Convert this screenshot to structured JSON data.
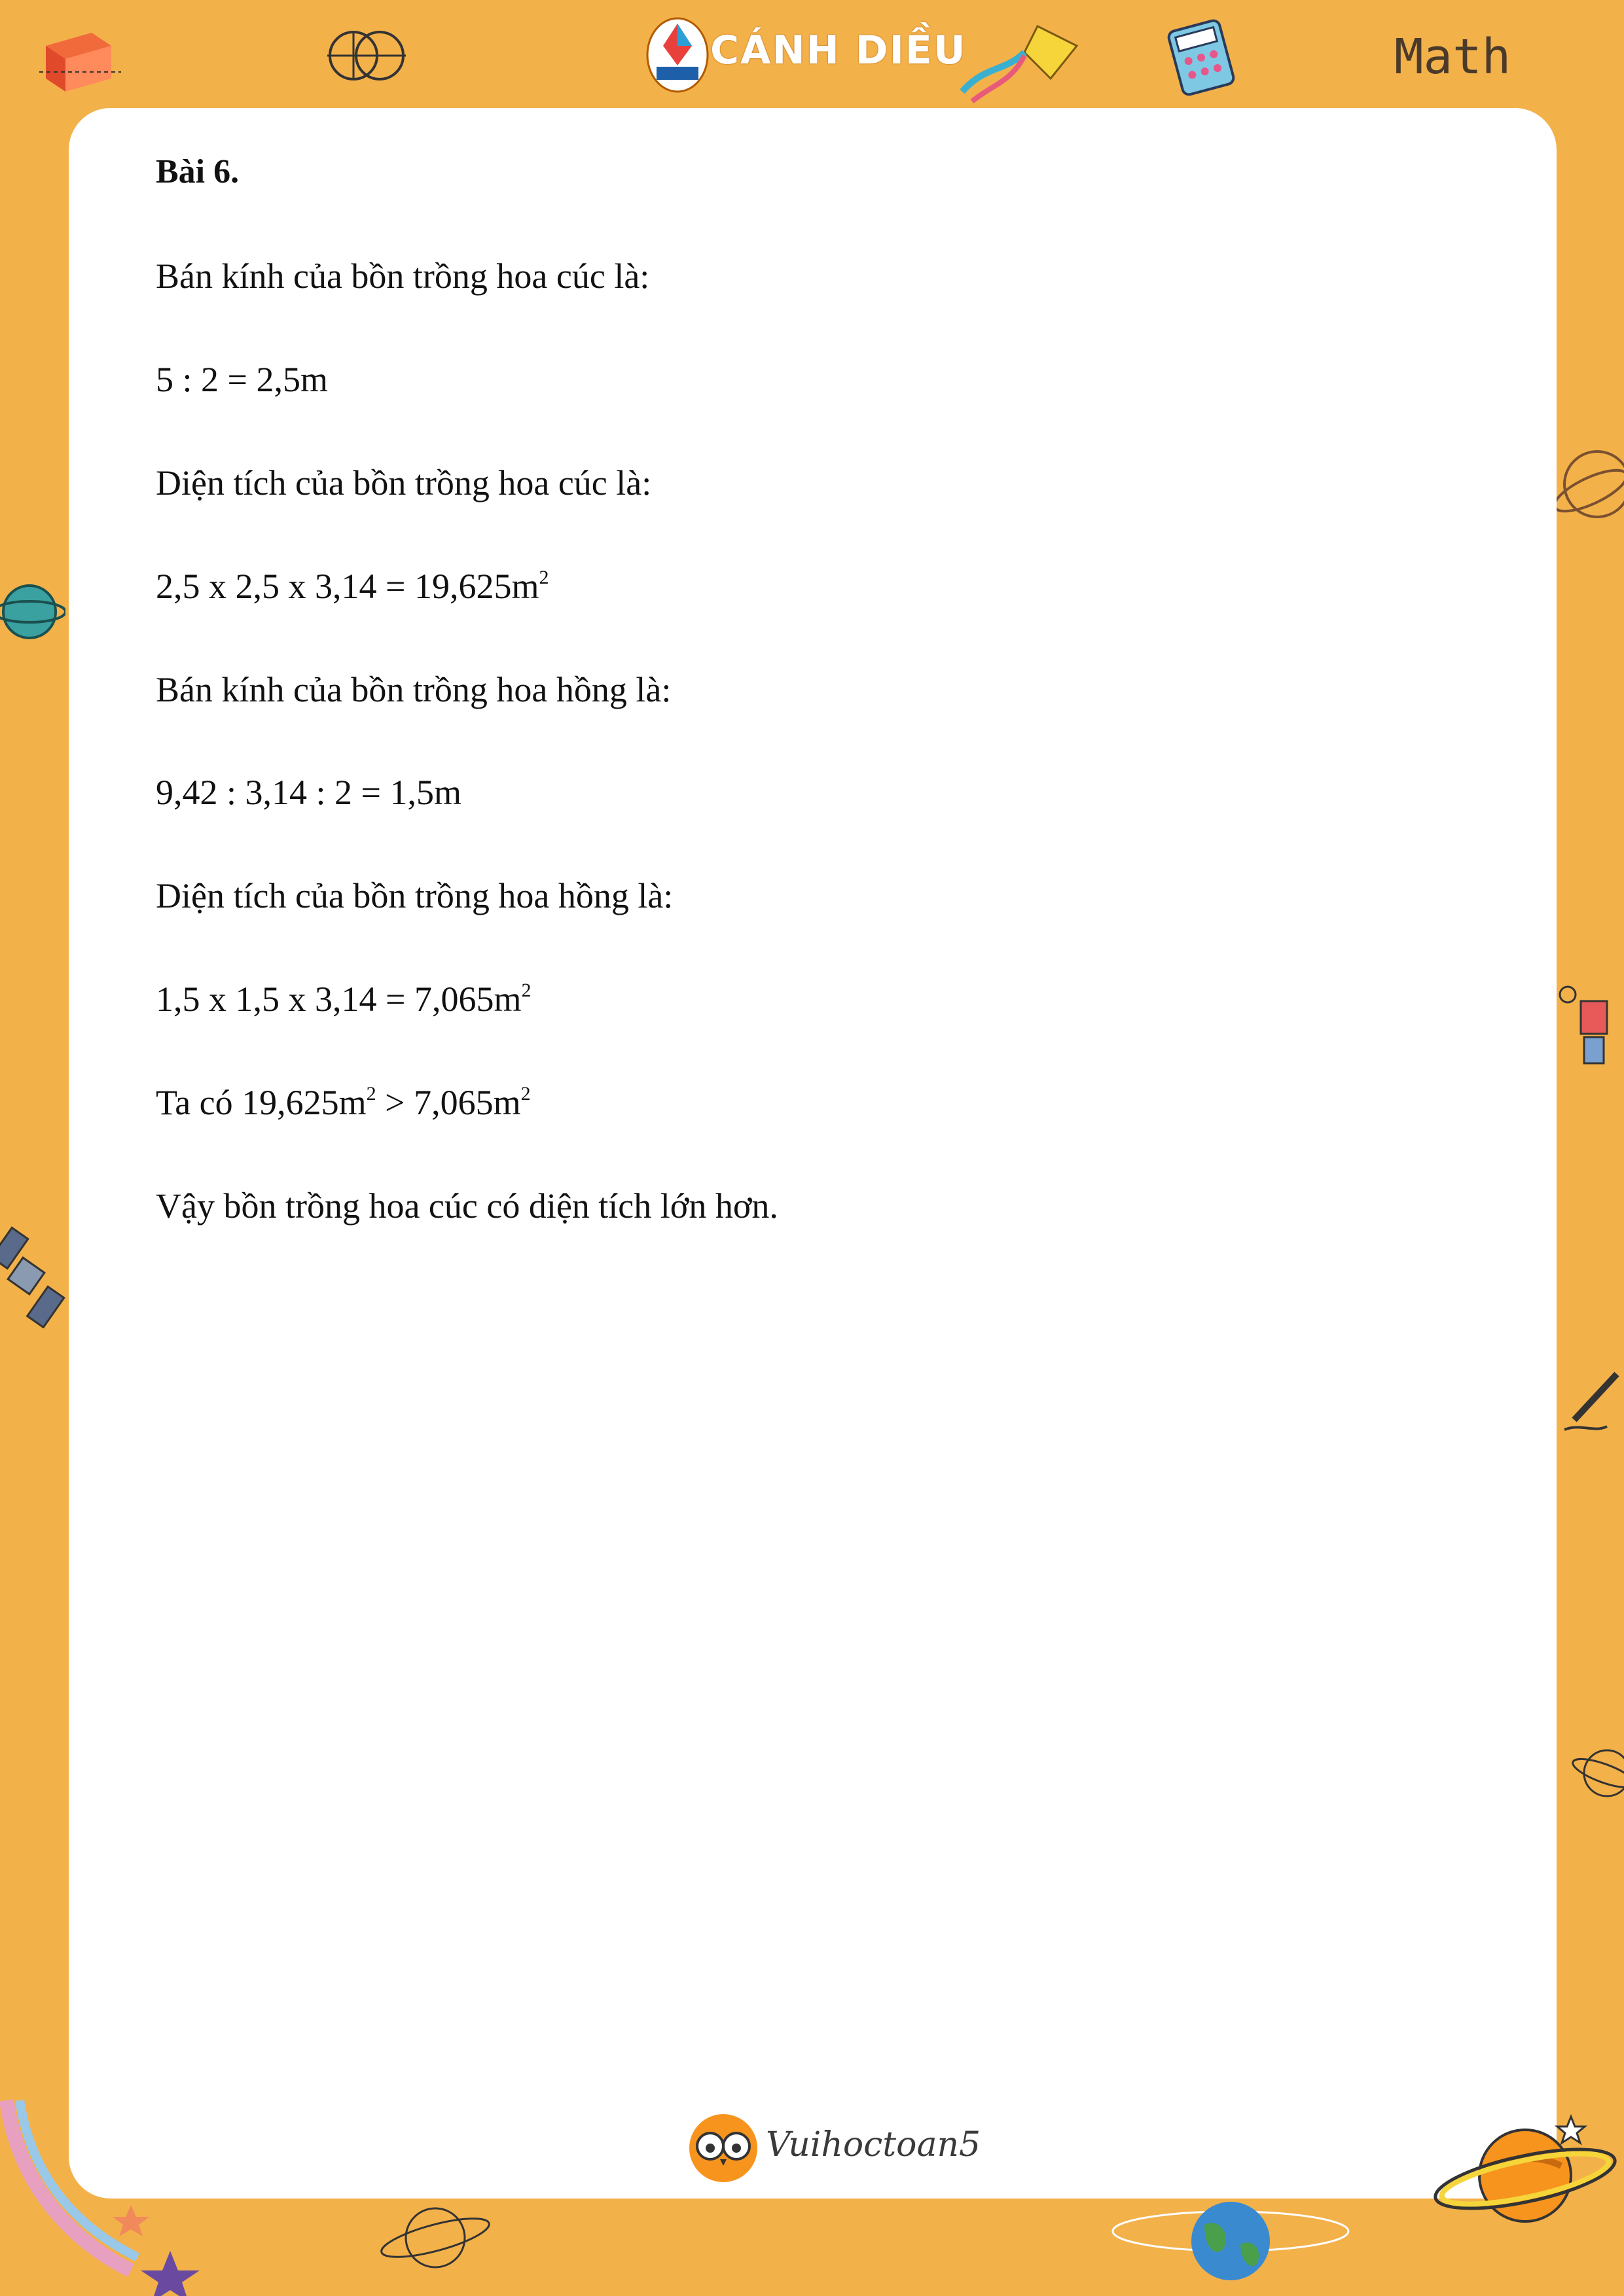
{
  "header": {
    "brand": "CÁNH DIỀU",
    "math_label": "Math"
  },
  "lesson": {
    "title": "Bài 6.",
    "lines": [
      {
        "text": "Bán kính của bồn trồng hoa cúc là:",
        "sup": ""
      },
      {
        "text": "5 : 2 = 2,5m",
        "sup": ""
      },
      {
        "text": "Diện tích của bồn trồng hoa cúc là:",
        "sup": ""
      },
      {
        "text": "2,5 x 2,5 x 3,14 = 19,625m",
        "sup": "2"
      },
      {
        "text": "Bán kính của bồn trồng hoa hồng là:",
        "sup": ""
      },
      {
        "text": "9,42 : 3,14 : 2 = 1,5m",
        "sup": ""
      },
      {
        "text": "Diện tích của bồn trồng hoa hồng là:",
        "sup": ""
      },
      {
        "text": "1,5 x 1,5 x 3,14 = 7,065m",
        "sup": "2"
      },
      {
        "text": "Ta có 19,625m",
        "sup": "2",
        "text2": " > 7,065m",
        "sup2": "2"
      },
      {
        "text": "Vậy bồn trồng hoa cúc có diện tích lớn hơn.",
        "sup": ""
      }
    ]
  },
  "footer": {
    "brand": "Vuihoctoan5"
  },
  "colors": {
    "frame": "#F3B14A",
    "paper": "#FFFFFF",
    "text": "#111111"
  },
  "icons": [
    "book-icon",
    "venn-diagram-icon",
    "canh-dieu-logo",
    "kite-icon",
    "calculator-icon",
    "planet-icon",
    "satellite-icon",
    "pencil-icon",
    "globe-icon",
    "owl-logo",
    "star-icon"
  ]
}
